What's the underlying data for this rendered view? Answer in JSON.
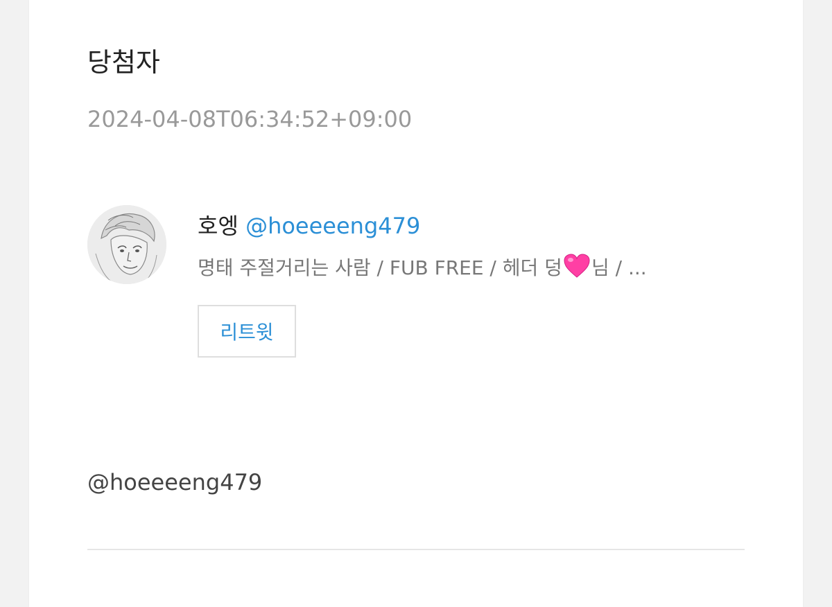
{
  "page": {
    "title": "당첨자",
    "timestamp": "2024-04-08T06:34:52+09:00"
  },
  "entry": {
    "display_name": "호엥",
    "handle": "@hoeeeeng479",
    "bio_before_heart": "명태 주절거리는 사람 / FUB FREE / 헤더 덩",
    "bio_after_heart": "님 / ...",
    "heart_icon": "pink-heart-emoji",
    "retweet_label": "리트윗"
  },
  "footer": {
    "winner_handle": "@hoeeeeng479"
  },
  "colors": {
    "link": "#2b8fd6",
    "muted": "#999999",
    "heart": "#ff3fa4",
    "background": "#f2f2f2"
  }
}
